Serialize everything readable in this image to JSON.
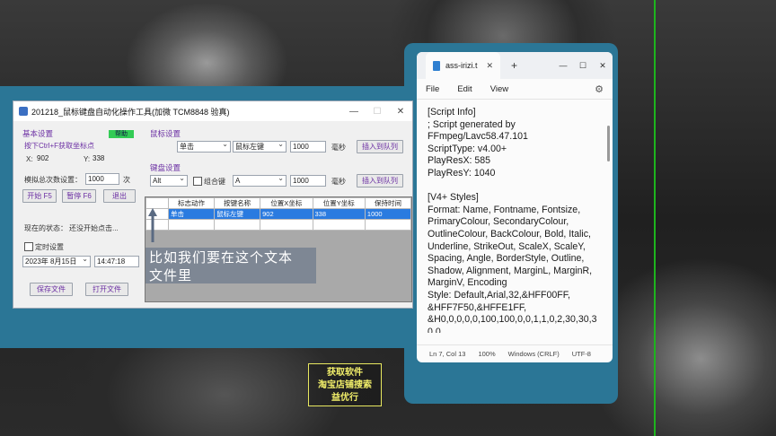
{
  "app": {
    "title": "201218_鼠标键盘自动化操作工具(加微 TCM8848 验真)",
    "window_controls": {
      "minimize": "—",
      "maximize": "☐",
      "close": "✕"
    },
    "basic_settings": {
      "label": "基本设置",
      "badge": "帮助",
      "coord_hint": "按下Ctrl+F获取坐标点",
      "x_label": "X:",
      "x_value": "902",
      "y_label": "Y:",
      "y_value": "338",
      "loop_label": "模拟总次数设置：",
      "loop_value": "1000",
      "loop_unit": "次",
      "start_button": "开始 F5",
      "pause_button": "暂停 F6",
      "exit_button": "退出",
      "status_label": "现在的状态：",
      "status_value": "还没开始点击...",
      "timer_label": "定时设置",
      "date_value": "2023年 8月15日",
      "time_value": "14:47:18",
      "save_button": "保存文件",
      "open_button": "打开文件"
    },
    "mouse_settings": {
      "label": "鼠标设置",
      "action_value": "单击",
      "button_value": "鼠标左键",
      "delay_value": "1000",
      "delay_unit": "毫秒",
      "insert_button": "插入到队列"
    },
    "keyboard_settings": {
      "label": "键盘设置",
      "modifier_value": "Alt",
      "combo_label": "组合键",
      "key_value": "A",
      "delay_value": "1000",
      "delay_unit": "毫秒",
      "insert_button": "插入到队列"
    },
    "table": {
      "columns": [
        "标志动作",
        "按键名称",
        "位置X坐标",
        "位置Y坐标",
        "保持时间"
      ],
      "rows": [
        {
          "action": "单击",
          "key": "鼠标左键",
          "x": "902",
          "y": "338",
          "hold": "1000"
        }
      ]
    }
  },
  "caption": {
    "line1": "比如我们要在这个文本",
    "line2": "文件里"
  },
  "notepad": {
    "tab_title": "ass-irizi.t",
    "tab_close": "✕",
    "new_tab": "+",
    "window_controls": {
      "minimize": "—",
      "maximize": "☐",
      "close": "✕"
    },
    "menu": [
      "File",
      "Edit",
      "View"
    ],
    "lines": [
      "[Script Info]",
      "; Script generated by",
      "FFmpeg/Lavc58.47.101",
      "ScriptType: v4.00+",
      "PlayResX: 585",
      "PlayResY: 1040",
      "",
      "[V4+ Styles]",
      "Format: Name, Fontname, Fontsize,",
      "PrimaryColour, SecondaryColour,",
      "OutlineColour, BackColour, Bold, Italic,",
      "Underline, StrikeOut, ScaleX, ScaleY,",
      "Spacing, Angle, BorderStyle, Outline,",
      "Shadow, Alignment, MarginL, MarginR,",
      "MarginV, Encoding",
      "Style: Default,Arial,32,&HFF00FF,",
      "&HFF7F50,&HFFE1FF,",
      "&H0,0,0,0,0,100,100,0,0,1,1,0,2,30,30,3",
      "0,0"
    ],
    "status": {
      "position": "Ln 7, Col 13",
      "zoom": "100%",
      "line_ending": "Windows (CRLF)",
      "encoding": "UTF-8"
    }
  },
  "promo": {
    "line1": "获取软件",
    "line2": "淘宝店铺搜索",
    "line3": "益优行"
  },
  "colors": {
    "teal_frame": "#2b7696",
    "highlight_row": "#2a7be0",
    "group_label": "#6b2fa3",
    "green_line": "#1db41d"
  }
}
